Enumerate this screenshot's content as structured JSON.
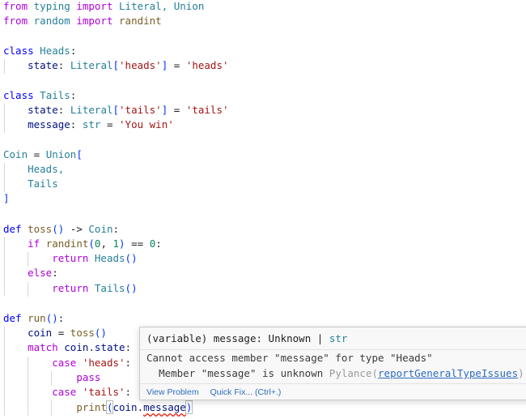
{
  "code": {
    "import_typing": {
      "from": "from",
      "module": "typing",
      "import": "import",
      "names": "Literal, Union"
    },
    "import_random": {
      "from": "from",
      "module": "random",
      "import": "import",
      "names": "randint"
    },
    "class_heads": {
      "kw": "class",
      "name": "Heads",
      "colon": ":"
    },
    "heads_state": {
      "attr": "state",
      "annot": "Literal",
      "lit": "'heads'",
      "value": "'heads'"
    },
    "class_tails": {
      "kw": "class",
      "name": "Tails",
      "colon": ":"
    },
    "tails_state": {
      "attr": "state",
      "annot": "Literal",
      "lit": "'tails'",
      "value": "'tails'"
    },
    "tails_message": {
      "attr": "message",
      "annot": "str",
      "value": "'You win'"
    },
    "coin_union": {
      "name": "Coin",
      "annot": "Union"
    },
    "coin_heads": "Heads,",
    "coin_tails": "Tails",
    "def_toss": {
      "kw": "def",
      "name": "toss",
      "ret": "Coin"
    },
    "if_line": {
      "kw": "if",
      "fn": "randint",
      "a": "0",
      "b": "1",
      "cmp": "0"
    },
    "return_heads": {
      "kw": "return",
      "cls": "Heads"
    },
    "else_line": "else",
    "return_tails": {
      "kw": "return",
      "cls": "Tails"
    },
    "def_run": {
      "kw": "def",
      "name": "run"
    },
    "coin_assign": {
      "var": "coin",
      "fn": "toss"
    },
    "match_line": {
      "kw": "match",
      "var": "coin",
      "attr": "state"
    },
    "case_heads": {
      "kw": "case",
      "value": "'heads'"
    },
    "pass_line": "pass",
    "case_tails": {
      "kw": "case",
      "value": "'tails'"
    },
    "print_line": {
      "fn": "print",
      "var": "coin",
      "attr": "message"
    }
  },
  "hover": {
    "signature_kind": "(variable)",
    "signature_name": "message",
    "signature_type1": "Unknown",
    "signature_pipe": "|",
    "signature_type2": "str",
    "error_line1": "Cannot access member \"message\" for type \"Heads\"",
    "error_line2": "Member \"message\" is unknown",
    "source": "Pylance",
    "rule": "reportGeneralTypeIssues",
    "action_view_problem": "View Problem",
    "action_quick_fix": "Quick Fix... (Ctrl+.)"
  },
  "colors": {
    "keyword": "#af00db",
    "control": "#0000ff",
    "class": "#267f99",
    "function": "#795e26",
    "variable": "#001080",
    "string": "#a31515",
    "number": "#098658",
    "error": "#e51400",
    "link": "#2e6bbf"
  }
}
